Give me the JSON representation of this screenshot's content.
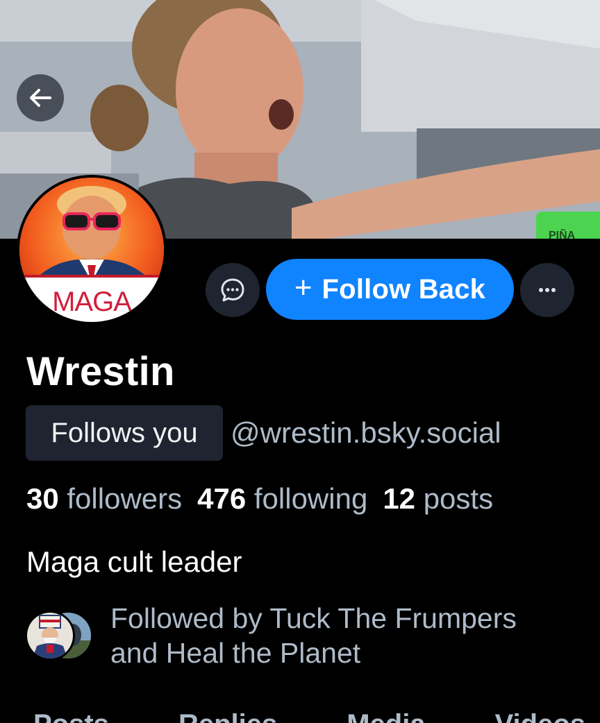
{
  "header": {
    "back_icon": "arrow-left-icon",
    "banner_sign_text": "PIÑA"
  },
  "avatar": {
    "badge_text": "MAGA"
  },
  "actions": {
    "message_icon": "chat-bubble-icon",
    "follow_plus": "+",
    "follow_label": "Follow Back",
    "more_icon": "ellipsis-icon"
  },
  "profile": {
    "display_name": "Wrestin",
    "follows_you_label": "Follows you",
    "handle": "@wrestin.bsky.social",
    "stats": {
      "followers_count": "30",
      "followers_label": "followers",
      "following_count": "476",
      "following_label": "following",
      "posts_count": "12",
      "posts_label": "posts"
    },
    "bio": "Maga cult leader",
    "followed_by": "Followed by Tuck The Frumpers and Heal the Planet"
  },
  "tabs": [
    "Posts",
    "Replies",
    "Media",
    "Videos"
  ],
  "colors": {
    "background": "#000000",
    "accent": "#1083fe",
    "muted_text": "#aebbc9",
    "chip_bg": "#1e2530"
  }
}
